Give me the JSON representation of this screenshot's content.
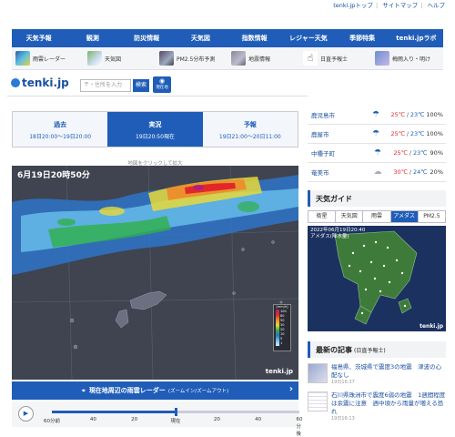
{
  "top_links": {
    "home": "tenki.jpトップ",
    "sitemap": "サイトマップ",
    "help": "ヘルプ"
  },
  "nav": [
    "天気予報",
    "観測",
    "防災情報",
    "天気図",
    "指数情報",
    "レジャー天気",
    "季節特集",
    "tenki.jpラボ"
  ],
  "subnav": [
    {
      "label": "雨雲レーダー",
      "icon": "radar-thumb"
    },
    {
      "label": "天気図",
      "icon": "weather-map-thumb"
    },
    {
      "label": "PM2.5分布予測",
      "icon": "pm25-thumb"
    },
    {
      "label": "地震情報",
      "icon": "earthquake-thumb"
    },
    {
      "label": "日直予報士",
      "icon": "forecaster-thumb"
    },
    {
      "label": "梅雨入り・明け",
      "icon": "rainy-season-thumb"
    }
  ],
  "header": {
    "logo": "tenki.jp",
    "search_placeholder": "〒・住所を入力",
    "search_button": "検索",
    "location_button": "現在地"
  },
  "period_tabs": [
    {
      "title": "過去",
      "sub": "18日20:00〜19日20:00",
      "active": false
    },
    {
      "title": "実況",
      "sub": "19日20:50現在",
      "active": true
    },
    {
      "title": "予報",
      "sub": "19日21:00〜20日11:00",
      "active": false
    }
  ],
  "map_hint": "地図をクリックして拡大",
  "map": {
    "timestamp": "6月19日20時50分",
    "legend_unit": "[mm/h]",
    "legend_values": [
      "100",
      "80",
      "50",
      "30",
      "20",
      "10",
      "5",
      "1"
    ],
    "logo": "tenki.jp"
  },
  "current_bar": {
    "label": "現在地周辺の雨雲レーダー",
    "sub": "(ズームイン/ズームアウト)"
  },
  "player": {
    "ticks": [
      "60分前",
      "40",
      "20",
      "現在",
      "20",
      "40",
      "60分後"
    ],
    "position": 0.5
  },
  "weather_rows": [
    {
      "city": "鹿児島市",
      "icon": "umbrella-icon",
      "glyph": "☂",
      "hi": "25℃",
      "lo": "23℃",
      "rain": "100%"
    },
    {
      "city": "鹿屋市",
      "icon": "umbrella-icon",
      "glyph": "☂",
      "hi": "25℃",
      "lo": "23℃",
      "rain": "100%"
    },
    {
      "city": "中種子町",
      "icon": "umbrella-icon",
      "glyph": "☂",
      "hi": "25℃",
      "lo": "23℃",
      "rain": "90%"
    },
    {
      "city": "奄美市",
      "icon": "cloud-icon",
      "glyph": "☁",
      "hi": "30℃",
      "lo": "24℃",
      "rain": "20%"
    }
  ],
  "guide": {
    "title": "天気ガイド",
    "tabs": [
      "衛星",
      "天気図",
      "雨雲",
      "アメダス",
      "PM2.5"
    ],
    "active_tab": "アメダス",
    "caption_line1": "2022年06月19日20:40",
    "caption_line2": "アメダス(降水量)",
    "logo": "tenki.jp"
  },
  "articles": {
    "title": "最新の記事",
    "title_sub": "(日直予報士)",
    "items": [
      {
        "text": "福島県、茨城県で震度3の地震　津波の心配なし",
        "date": "19日16:37"
      },
      {
        "text": "石川県珠洲市で震度6弱の地震　1週間程度は余震に注意　週中頃から雨量が増える恐れ",
        "date": "19日16:13"
      }
    ]
  }
}
